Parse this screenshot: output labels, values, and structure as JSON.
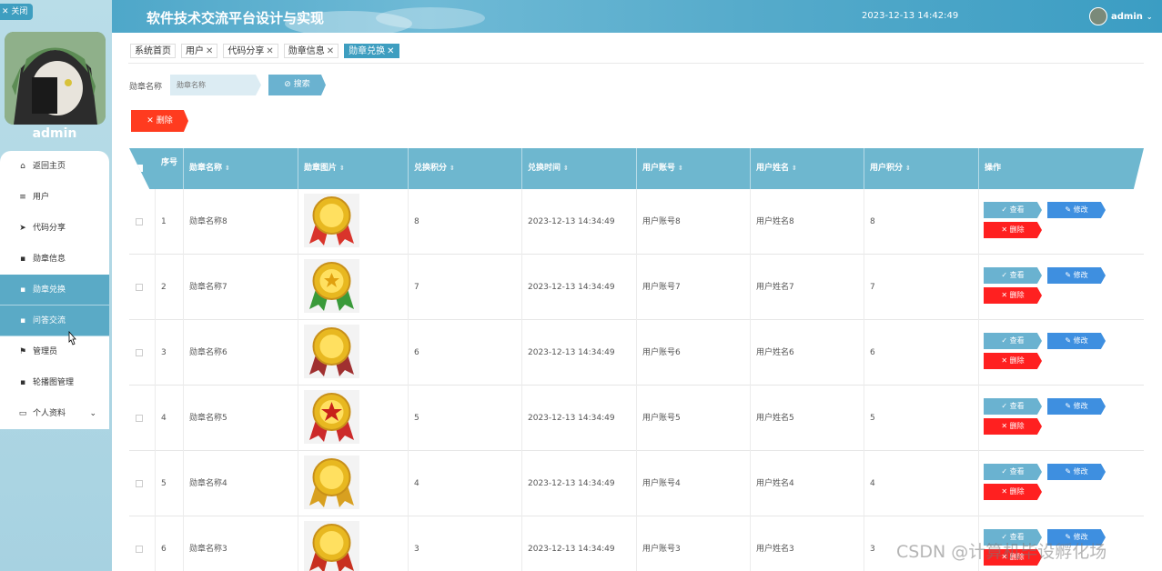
{
  "sidebar": {
    "close_label": "✕ 关闭",
    "username": "admin",
    "items": [
      {
        "icon": "home-icon",
        "glyph": "⌂",
        "label": "返回主页"
      },
      {
        "icon": "list-icon",
        "glyph": "≡",
        "label": "用户"
      },
      {
        "icon": "send-icon",
        "glyph": "➤",
        "label": "代码分享"
      },
      {
        "icon": "grid-icon",
        "glyph": "▪",
        "label": "勋章信息"
      },
      {
        "icon": "box-icon",
        "glyph": "▪",
        "label": "勋章兑换"
      },
      {
        "icon": "grid-icon",
        "glyph": "▪",
        "label": "问答交流"
      },
      {
        "icon": "flag-icon",
        "glyph": "⚑",
        "label": "管理员"
      },
      {
        "icon": "image-icon",
        "glyph": "▪",
        "label": "轮播图管理"
      },
      {
        "icon": "card-icon",
        "glyph": "▭",
        "label": "个人资料"
      }
    ]
  },
  "header": {
    "title": "软件技术交流平台设计与实现",
    "datetime": "2023-12-13 14:42:49",
    "user": "admin"
  },
  "tabs": [
    {
      "label": "系统首页"
    },
    {
      "label": "用户"
    },
    {
      "label": "代码分享"
    },
    {
      "label": "勋章信息"
    },
    {
      "label": "勋章兑换"
    }
  ],
  "search": {
    "label": "勋章名称",
    "placeholder": "勋章名称",
    "button": "搜索"
  },
  "toolbar": {
    "delete_label": "删除"
  },
  "table": {
    "headers": {
      "seq": "序号",
      "name": "勋章名称",
      "image": "勋章图片",
      "points": "兑换积分",
      "time": "兑换时间",
      "account": "用户账号",
      "username": "用户姓名",
      "user_points": "用户积分",
      "actions": "操作"
    },
    "actions": {
      "view": "查看",
      "edit": "修改",
      "delete": "删除"
    },
    "rows": [
      {
        "seq": "1",
        "name": "勋章名称8",
        "points": "8",
        "time": "2023-12-13 14:34:49",
        "account": "用户账号8",
        "username": "用户姓名8",
        "user_points": "8"
      },
      {
        "seq": "2",
        "name": "勋章名称7",
        "points": "7",
        "time": "2023-12-13 14:34:49",
        "account": "用户账号7",
        "username": "用户姓名7",
        "user_points": "7"
      },
      {
        "seq": "3",
        "name": "勋章名称6",
        "points": "6",
        "time": "2023-12-13 14:34:49",
        "account": "用户账号6",
        "username": "用户姓名6",
        "user_points": "6"
      },
      {
        "seq": "4",
        "name": "勋章名称5",
        "points": "5",
        "time": "2023-12-13 14:34:49",
        "account": "用户账号5",
        "username": "用户姓名5",
        "user_points": "5"
      },
      {
        "seq": "5",
        "name": "勋章名称4",
        "points": "4",
        "time": "2023-12-13 14:34:49",
        "account": "用户账号4",
        "username": "用户姓名4",
        "user_points": "4"
      },
      {
        "seq": "6",
        "name": "勋章名称3",
        "points": "3",
        "time": "2023-12-13 14:34:49",
        "account": "用户账号3",
        "username": "用户姓名3",
        "user_points": "3"
      }
    ]
  },
  "watermark": "CSDN @计算机毕设孵化场",
  "colors": {
    "accent": "#3e9ec0",
    "header_row": "#6eb7cf",
    "danger": "#ff2020",
    "edit": "#3e8fe0"
  }
}
